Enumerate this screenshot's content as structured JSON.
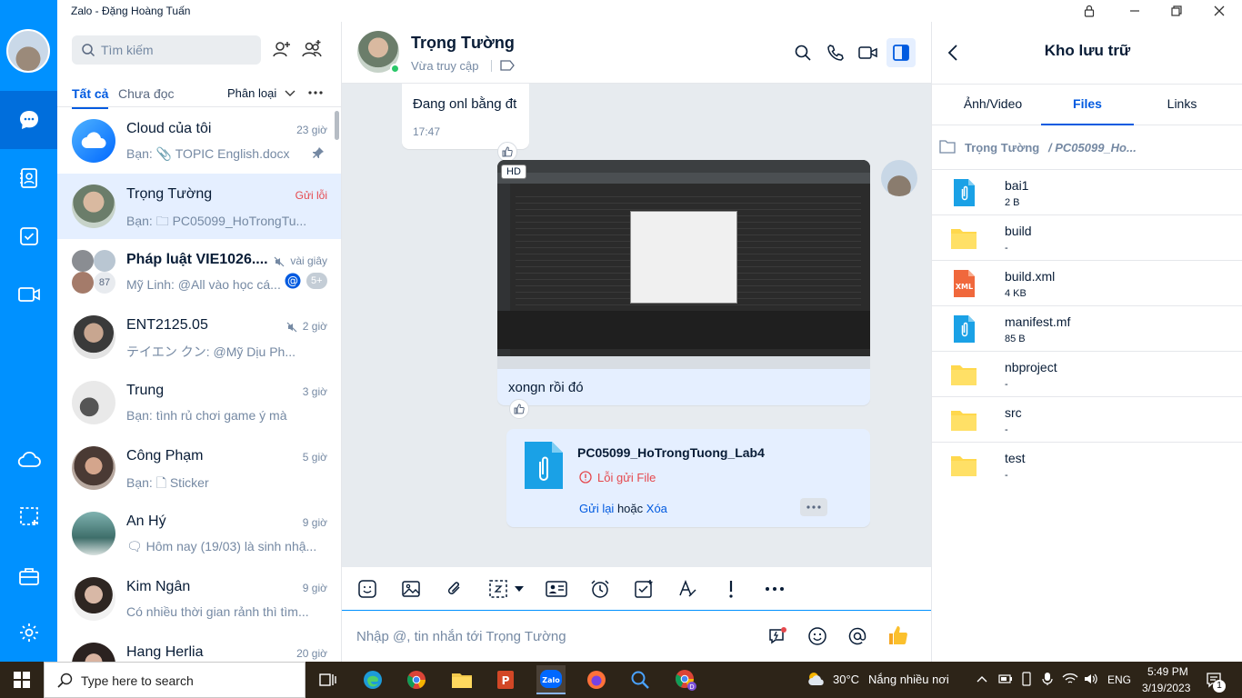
{
  "window": {
    "title": "Zalo - Đặng Hoàng Tuấn"
  },
  "conversation_list": {
    "search_placeholder": "Tìm kiếm",
    "filters": {
      "all": "Tất cả",
      "unread": "Chưa đọc",
      "classify": "Phân loại"
    },
    "items": [
      {
        "name": "Cloud của tôi",
        "time": "23 giờ",
        "preview": "Bạn: 📎 TOPIC English.docx"
      },
      {
        "name": "Trọng Tường",
        "time": "Gửi lỗi",
        "preview": "Bạn: 🗀 PC05099_HoTrongTu..."
      },
      {
        "name": "Pháp luật VIE1026....",
        "time": "vài giây",
        "preview": "Mỹ Linh: @All vào học cá...",
        "badge": "5+",
        "member_count": "87"
      },
      {
        "name": "ENT2125.05",
        "time": "2 giờ",
        "preview": "テイエン クン: @Mỹ Dịu Ph..."
      },
      {
        "name": "Trung",
        "time": "3 giờ",
        "preview": "Bạn: tình rủ chơi game ý mà"
      },
      {
        "name": "Công Phạm",
        "time": "5 giờ",
        "preview": "Bạn: 🗋 Sticker"
      },
      {
        "name": "An Hý",
        "time": "9 giờ",
        "preview": "🗨 Hôm nay (19/03) là sinh nhậ..."
      },
      {
        "name": "Kim Ngân",
        "time": "9 giờ",
        "preview": "Có nhiều thời gian rảnh thì tìm..."
      },
      {
        "name": "Hang Herlia",
        "time": "20 giờ",
        "preview": ""
      }
    ]
  },
  "chat": {
    "contact_name": "Trọng Tường",
    "status": "Vừa truy cập",
    "messages": {
      "msg1_text": "Đang onl bằng đt",
      "msg1_time": "17:47",
      "image_badge": "HD",
      "msg2_caption": "xongn rồi đó",
      "file_name": "PC05099_HoTrongTuong_Lab4",
      "file_error": "Lỗi gửi File",
      "resend": "Gửi lại",
      "or": "hoặc",
      "delete": "Xóa"
    },
    "input_placeholder": "Nhập @, tin nhắn tới Trọng Tường"
  },
  "storage_panel": {
    "title": "Kho lưu trữ",
    "tabs": [
      "Ảnh/Video",
      "Files",
      "Links"
    ],
    "active_tab": "Files",
    "path_root": "Trọng Tường",
    "path_sub": "/ PC05099_Ho...",
    "files": [
      {
        "name": "bai1",
        "size": "2 B",
        "icon": "file-attach-icon"
      },
      {
        "name": "build",
        "size": "-",
        "icon": "folder-icon"
      },
      {
        "name": "build.xml",
        "size": "4 KB",
        "icon": "xml-file-icon"
      },
      {
        "name": "manifest.mf",
        "size": "85 B",
        "icon": "file-attach-icon"
      },
      {
        "name": "nbproject",
        "size": "-",
        "icon": "folder-icon"
      },
      {
        "name": "src",
        "size": "-",
        "icon": "folder-icon"
      },
      {
        "name": "test",
        "size": "-",
        "icon": "folder-icon"
      }
    ]
  },
  "taskbar": {
    "search_placeholder": "Type here to search",
    "weather": "30°C",
    "weather_text": "Nắng nhiều nơi",
    "lang": "ENG",
    "time": "5:49 PM",
    "date": "3/19/2023",
    "notif_count": "1"
  },
  "colors": {
    "primary": "#0091ff",
    "accent": "#005ae0",
    "error": "#e5484d"
  }
}
